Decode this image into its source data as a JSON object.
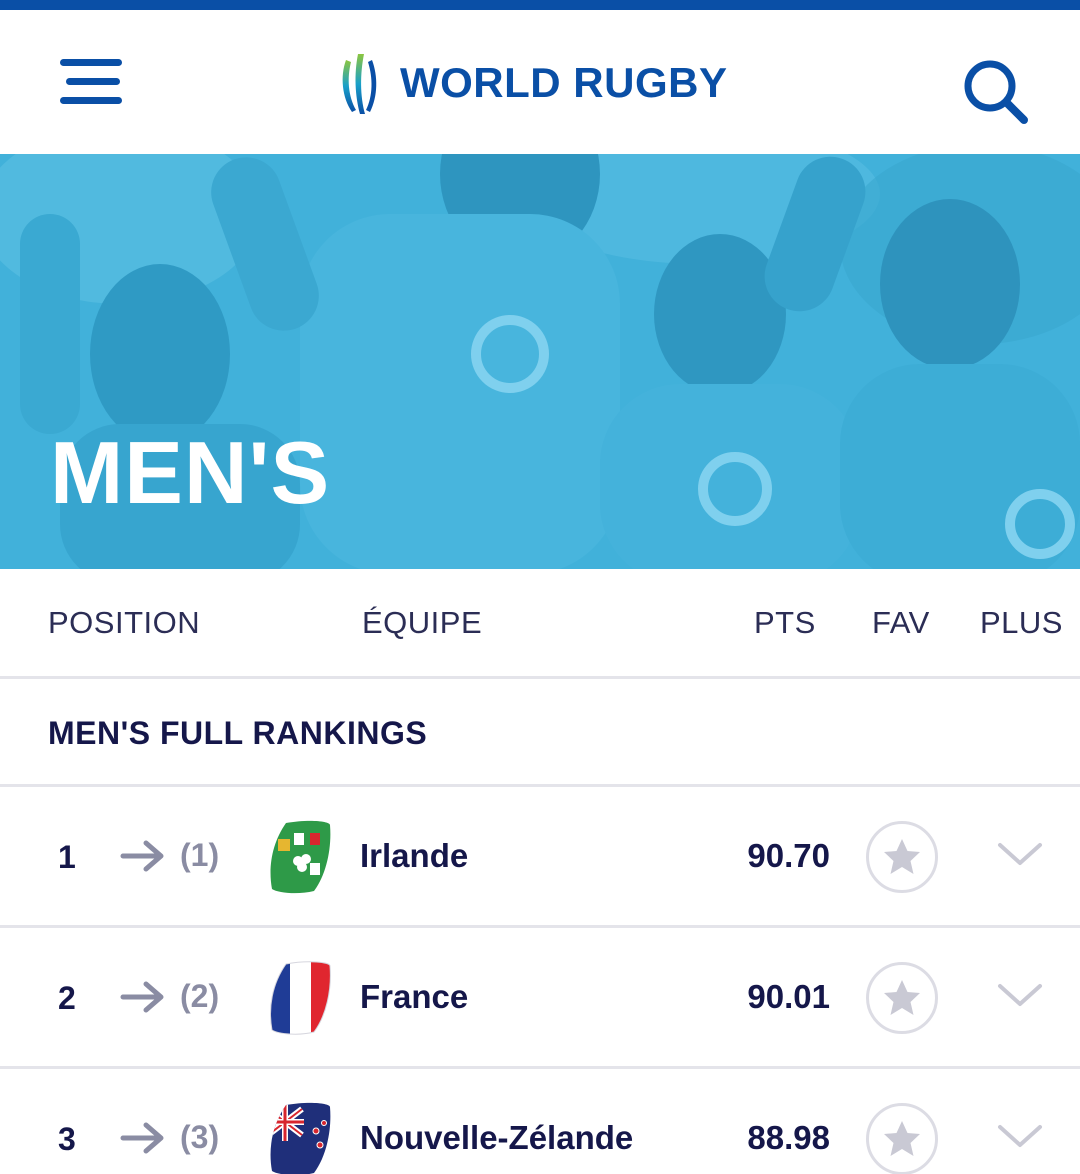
{
  "header": {
    "logo_text": "WORLD RUGBY",
    "menu_icon": "hamburger-menu-icon",
    "search_icon": "search-icon",
    "accent_color": "#0a4fa6"
  },
  "hero": {
    "title": "MEN'S",
    "tint_color": "#3fb0d9"
  },
  "columns": {
    "position": "POSITION",
    "team": "ÉQUIPE",
    "pts": "PTS",
    "fav": "FAV",
    "more": "PLUS"
  },
  "section": {
    "title": "MEN'S FULL RANKINGS"
  },
  "rankings": [
    {
      "rank": "1",
      "previous": "(1)",
      "team": "Irlande",
      "points": "90.70",
      "movement_icon": "arrow-right-icon",
      "flag_icon": "ireland-flag-icon"
    },
    {
      "rank": "2",
      "previous": "(2)",
      "team": "France",
      "points": "90.01",
      "movement_icon": "arrow-right-icon",
      "flag_icon": "france-flag-icon"
    },
    {
      "rank": "3",
      "previous": "(3)",
      "team": "Nouvelle-Zélande",
      "points": "88.98",
      "movement_icon": "arrow-right-icon",
      "flag_icon": "new-zealand-flag-icon"
    }
  ]
}
